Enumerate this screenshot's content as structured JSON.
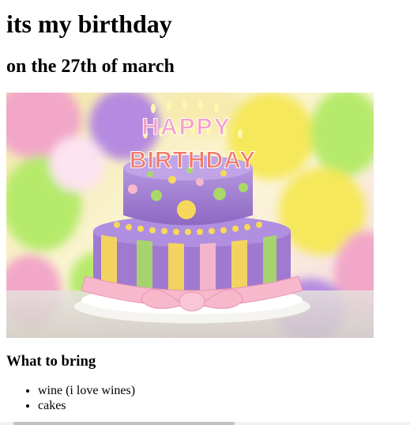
{
  "page": {
    "heading": "its my birthday",
    "subheading": "on the 27th of march"
  },
  "image": {
    "cake_topper_line1": "HAPPY",
    "cake_topper_line2": "BIRTHDAY",
    "colors": {
      "balloon_yellow": "#f5e85a",
      "balloon_green": "#b6ea6a",
      "balloon_purple": "#b58ae0",
      "balloon_pink": "#f2a7c8",
      "cake_purple": "#a07ad0",
      "cake_yellow": "#f7d85a",
      "cake_green": "#a8d86a",
      "ribbon_pink": "#f7b8cc",
      "plate_white": "#f6f4f0"
    }
  },
  "section": {
    "title": "What to bring",
    "items": [
      "wine (i love wines)",
      "cakes"
    ]
  }
}
